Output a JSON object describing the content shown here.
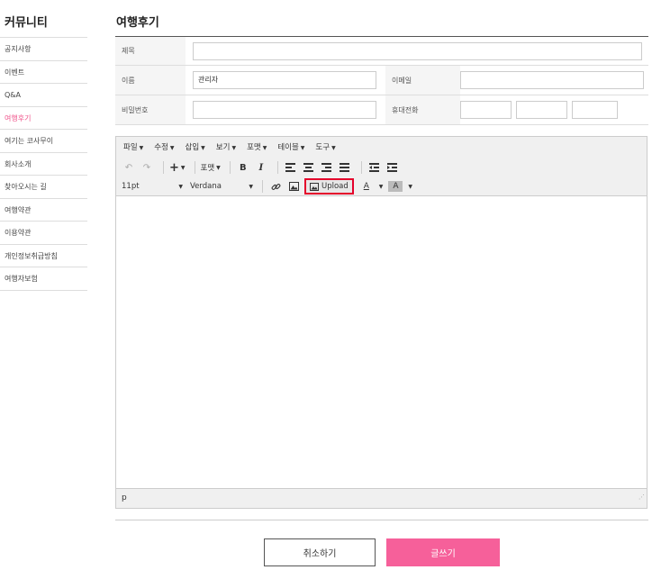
{
  "sidebar": {
    "title": "커뮤니티",
    "items": [
      {
        "label": "공지사항"
      },
      {
        "label": "이벤트"
      },
      {
        "label": "Q&A"
      },
      {
        "label": "여행후기",
        "active": true
      },
      {
        "label": "여기는 코사무이"
      },
      {
        "label": "회사소개"
      },
      {
        "label": "찾아오시는 길"
      },
      {
        "label": "여행약관"
      },
      {
        "label": "이용약관"
      },
      {
        "label": "개인정보취급방침"
      },
      {
        "label": "여행자보험"
      }
    ]
  },
  "page": {
    "title": "여행후기"
  },
  "form": {
    "subject_label": "제목",
    "name_label": "이름",
    "name_value": "관리자",
    "email_label": "이메일",
    "password_label": "비밀번호",
    "phone_label": "휴대전화"
  },
  "editor": {
    "menus": [
      "파일",
      "수정",
      "삽입",
      "보기",
      "포맷",
      "테이블",
      "도구"
    ],
    "format_label": "포맷",
    "font_size": "11pt",
    "font_family": "Verdana",
    "upload_label": "Upload",
    "status_path": "p"
  },
  "buttons": {
    "cancel": "취소하기",
    "write": "글쓰기"
  },
  "colors": {
    "accent": "#f6609a",
    "highlight": "#e4002b"
  }
}
